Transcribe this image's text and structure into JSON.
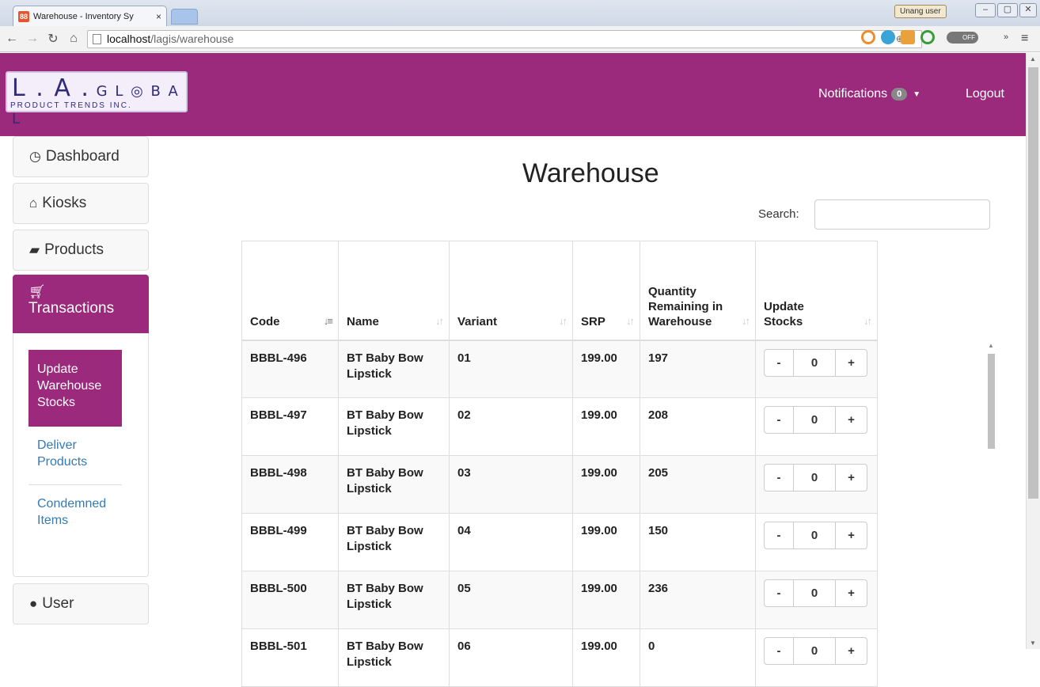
{
  "browser": {
    "tab_title": "Warehouse - Inventory Sy",
    "tab_close": "×",
    "url_host": "localhost",
    "url_path": "/lagis/warehouse",
    "user_badge": "Unang user",
    "toggle_label": "OFF"
  },
  "header": {
    "logo_main": "L.A.GL◎BAL",
    "logo_sub": "PRODUCT TRENDS INC.",
    "notifications_label": "Notifications",
    "notifications_count": "0",
    "logout_label": "Logout"
  },
  "sidebar": {
    "dashboard": "Dashboard",
    "kiosks": "Kiosks",
    "products": "Products",
    "transactions": "Transactions",
    "sub_update": "Update Warehouse Stocks",
    "sub_deliver": "Deliver Products",
    "sub_condemned": "Condemned Items",
    "user": "User"
  },
  "main": {
    "title": "Warehouse",
    "search_label": "Search:",
    "search_value": ""
  },
  "table": {
    "headers": [
      "Code",
      "Name",
      "Variant",
      "SRP",
      "Quantity Remaining in Warehouse",
      "Update Stocks"
    ],
    "rows": [
      {
        "code": "BBBL-496",
        "name": "BT Baby Bow Lipstick",
        "variant": "01",
        "srp": "199.00",
        "qty": "197",
        "update": "0"
      },
      {
        "code": "BBBL-497",
        "name": "BT Baby Bow Lipstick",
        "variant": "02",
        "srp": "199.00",
        "qty": "208",
        "update": "0"
      },
      {
        "code": "BBBL-498",
        "name": "BT Baby Bow Lipstick",
        "variant": "03",
        "srp": "199.00",
        "qty": "205",
        "update": "0"
      },
      {
        "code": "BBBL-499",
        "name": "BT Baby Bow Lipstick",
        "variant": "04",
        "srp": "199.00",
        "qty": "150",
        "update": "0"
      },
      {
        "code": "BBBL-500",
        "name": "BT Baby Bow Lipstick",
        "variant": "05",
        "srp": "199.00",
        "qty": "236",
        "update": "0"
      },
      {
        "code": "BBBL-501",
        "name": "BT Baby Bow Lipstick",
        "variant": "06",
        "srp": "199.00",
        "qty": "0",
        "update": "0"
      }
    ],
    "minus_label": "-",
    "plus_label": "+"
  },
  "colors": {
    "brand": "#9b2a7d",
    "link": "#337ab7"
  }
}
